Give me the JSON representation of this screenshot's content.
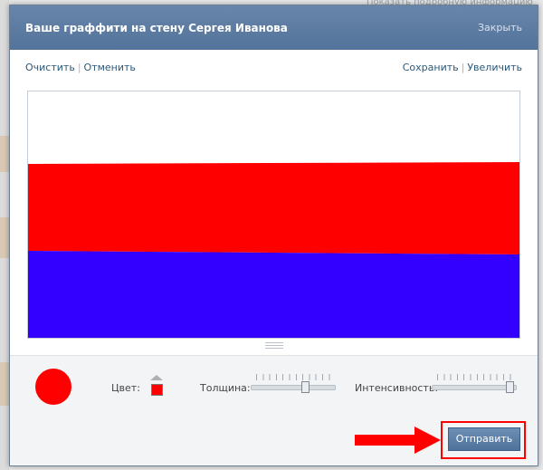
{
  "background": {
    "top_text": "Показать подробную информацию"
  },
  "dialog": {
    "title": "Ваше граффити на стену Сергея Иванова",
    "close_label": "Закрыть"
  },
  "toolbar": {
    "clear_label": "Очистить",
    "undo_label": "Отменить",
    "save_label": "Сохранить",
    "zoom_label": "Увеличить"
  },
  "canvas": {
    "stripes": [
      {
        "color": "#ffffff"
      },
      {
        "color": "#ff0000"
      },
      {
        "color": "#3300ff"
      }
    ]
  },
  "controls": {
    "color_label": "Цвет:",
    "selected_color": "#ff0000",
    "thickness_label": "Толщина:",
    "thickness_value": 0.66,
    "intensity_label": "Интенсивность:",
    "intensity_value": 0.96
  },
  "footer": {
    "send_label": "Отправить",
    "arrow_color": "#ff0000"
  }
}
